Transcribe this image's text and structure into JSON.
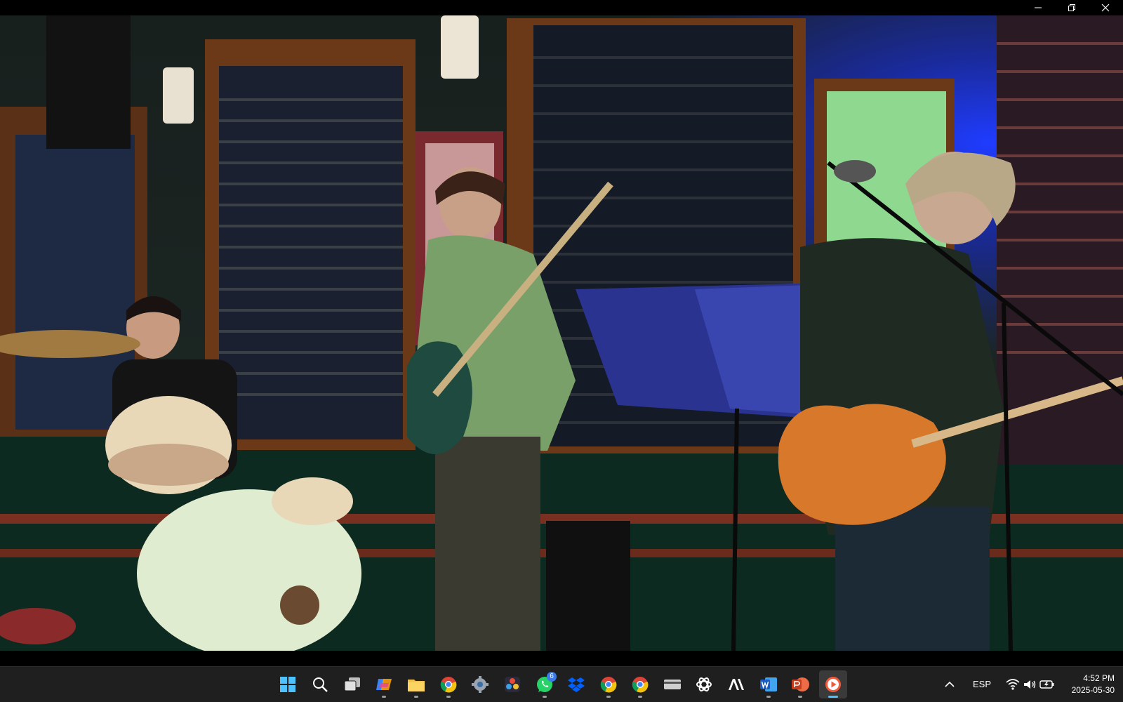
{
  "window": {
    "controls": {
      "minimize": "minimize",
      "maximize": "restore",
      "close": "close"
    }
  },
  "video": {
    "scene": "live-band-performance"
  },
  "taskbar": {
    "apps": [
      {
        "name": "start",
        "icon": "windows-logo-icon"
      },
      {
        "name": "search",
        "icon": "search-icon"
      },
      {
        "name": "task-view",
        "icon": "task-view-icon"
      },
      {
        "name": "copilot",
        "icon": "copilot-icon"
      },
      {
        "name": "file-explorer",
        "icon": "folder-icon"
      },
      {
        "name": "chrome-1",
        "icon": "chrome-icon"
      },
      {
        "name": "settings",
        "icon": "gear-icon"
      },
      {
        "name": "davinci-resolve",
        "icon": "resolve-icon"
      },
      {
        "name": "whatsapp",
        "icon": "whatsapp-icon",
        "badge": "6"
      },
      {
        "name": "dropbox",
        "icon": "dropbox-icon"
      },
      {
        "name": "chrome-2",
        "icon": "chrome-icon"
      },
      {
        "name": "chrome-3",
        "icon": "chrome-icon"
      },
      {
        "name": "card-reader",
        "icon": "card-icon"
      },
      {
        "name": "chatgpt",
        "icon": "chatgpt-icon"
      },
      {
        "name": "anthropic",
        "icon": "anthropic-icon"
      },
      {
        "name": "word",
        "icon": "word-icon"
      },
      {
        "name": "powerpoint",
        "icon": "powerpoint-icon"
      },
      {
        "name": "media-player",
        "icon": "play-icon"
      }
    ],
    "tray": {
      "language": "ESP",
      "time": "4:52 PM",
      "date": "2025-05-30"
    },
    "colors": {
      "accent": "#4cc2ff",
      "background": "#1f1f1f"
    }
  }
}
